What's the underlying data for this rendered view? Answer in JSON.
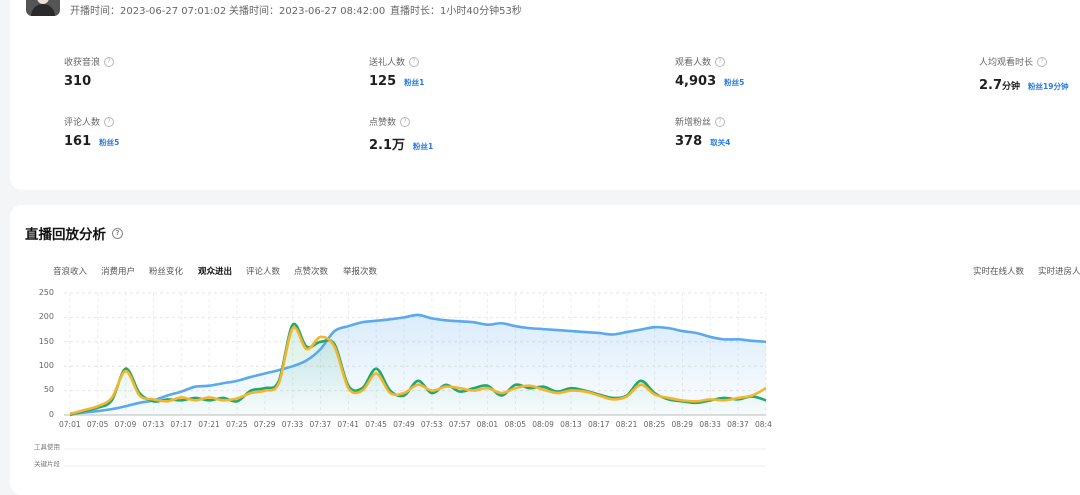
{
  "header": {
    "start_time": "开播时间：2023-06-27 07:01:02",
    "end_time": "关播时间：2023-06-27 08:42:00",
    "duration": "直播时长：1小时40分钟53秒"
  },
  "metrics": [
    {
      "label": "收获音浪",
      "value": "310",
      "unit": "",
      "sub": ""
    },
    {
      "label": "送礼人数",
      "value": "125",
      "unit": "",
      "sub": "粉丝1"
    },
    {
      "label": "观看人数",
      "value": "4,903",
      "unit": "",
      "sub": "粉丝5"
    },
    {
      "label": "人均观看时长",
      "value": "2.7",
      "unit": "分钟",
      "sub": "粉丝19分钟"
    },
    {
      "label": "评论人数",
      "value": "161",
      "unit": "",
      "sub": "粉丝5"
    },
    {
      "label": "点赞数",
      "value": "2.1万",
      "unit": "",
      "sub": "粉丝1"
    },
    {
      "label": "新增粉丝",
      "value": "378",
      "unit": "",
      "sub": "取关4"
    }
  ],
  "section": {
    "title": "直播回放分析",
    "tabs": [
      "音浪收入",
      "消费用户",
      "粉丝变化",
      "观众进出",
      "评论人数",
      "点赞次数",
      "举报次数"
    ],
    "active_tab": 3,
    "right_tabs": [
      "实时在线人数",
      "实时进房人"
    ]
  },
  "bottom_rows": [
    "工具使用",
    "关键片段"
  ],
  "colors": {
    "blue": "#5aa8ee",
    "green": "#22a86a",
    "orange": "#f2b530"
  },
  "chart_data": {
    "type": "line",
    "ylim": [
      0,
      250
    ],
    "yticks": [
      "0",
      "50",
      "100",
      "150",
      "200",
      "250"
    ],
    "x_labels": [
      "07:01",
      "07:05",
      "07:09",
      "07:13",
      "07:17",
      "07:21",
      "07:25",
      "07:29",
      "07:33",
      "07:37",
      "07:41",
      "07:45",
      "07:49",
      "07:53",
      "07:57",
      "08:01",
      "08:05",
      "08:09",
      "08:13",
      "08:17",
      "08:21",
      "08:25",
      "08:29",
      "08:33",
      "08:37",
      "08:4"
    ],
    "series": [
      {
        "color": "blue",
        "values": [
          3,
          5,
          8,
          12,
          18,
          25,
          30,
          40,
          48,
          58,
          60,
          65,
          70,
          78,
          85,
          92,
          100,
          112,
          135,
          172,
          182,
          190,
          193,
          196,
          200,
          205,
          198,
          194,
          192,
          190,
          185,
          188,
          182,
          178,
          176,
          174,
          172,
          170,
          168,
          165,
          170,
          175,
          180,
          178,
          172,
          168,
          160,
          155,
          155,
          152,
          150
        ]
      },
      {
        "color": "green",
        "values": [
          0,
          8,
          15,
          30,
          95,
          45,
          28,
          32,
          30,
          35,
          30,
          35,
          28,
          50,
          55,
          70,
          185,
          140,
          150,
          145,
          60,
          55,
          95,
          50,
          40,
          70,
          45,
          62,
          48,
          55,
          60,
          40,
          62,
          55,
          58,
          48,
          55,
          50,
          42,
          35,
          40,
          70,
          45,
          32,
          28,
          25,
          30,
          35,
          32,
          38,
          30
        ]
      },
      {
        "color": "orange",
        "values": [
          2,
          10,
          18,
          35,
          90,
          40,
          32,
          28,
          36,
          30,
          36,
          30,
          34,
          45,
          50,
          65,
          178,
          135,
          160,
          140,
          55,
          50,
          85,
          45,
          45,
          62,
          50,
          58,
          55,
          50,
          55,
          45,
          55,
          60,
          52,
          45,
          50,
          48,
          40,
          32,
          38,
          62,
          42,
          35,
          30,
          28,
          32,
          30,
          35,
          40,
          55
        ]
      }
    ]
  }
}
